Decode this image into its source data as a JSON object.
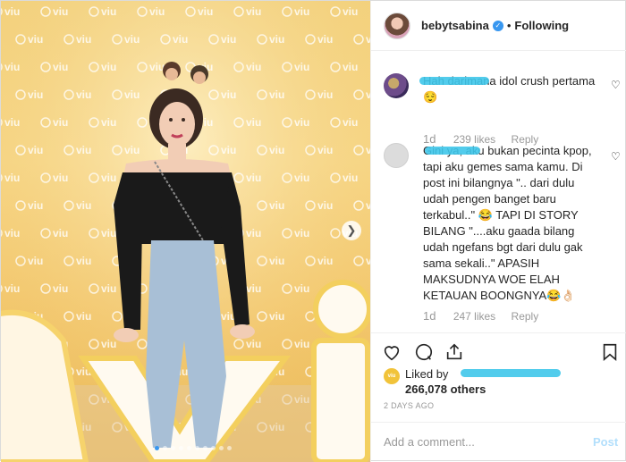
{
  "header": {
    "username": "bebytsabina",
    "separator": "•",
    "follow_status": "Following"
  },
  "photo": {
    "watermark_text": "viu",
    "has_next_arrow": true
  },
  "comments": [
    {
      "username": "",
      "text": "Hah darimana idol crush pertama 😌",
      "time": "1d",
      "likes": "239 likes",
      "reply": "Reply"
    },
    {
      "username": "",
      "text": "Gini ya, aku bukan pecinta kpop, tapi aku gemes sama kamu. Di post ini bilangnya \".. dari dulu udah pengen banget baru terkabul..\" 😂 TAPI DI STORY BILANG \"....aku gaada bilang udah ngefans bgt dari dulu gak sama sekali..\" APASIH MAKSUDNYA WOE ELAH KETAUAN BOONGNYA😂👌🏻",
      "time": "1d",
      "likes": "247 likes",
      "reply": "Reply"
    }
  ],
  "likes": {
    "prefix": "Liked by",
    "count_text": "266,078 others",
    "avatar_label": "viu"
  },
  "date": "2 DAYS AGO",
  "add_comment": {
    "placeholder": "Add a comment...",
    "post_label": "Post"
  },
  "colors": {
    "verified": "#3897f0",
    "redaction": "#3fc6ea",
    "photo_bg": "#f3d27e"
  }
}
